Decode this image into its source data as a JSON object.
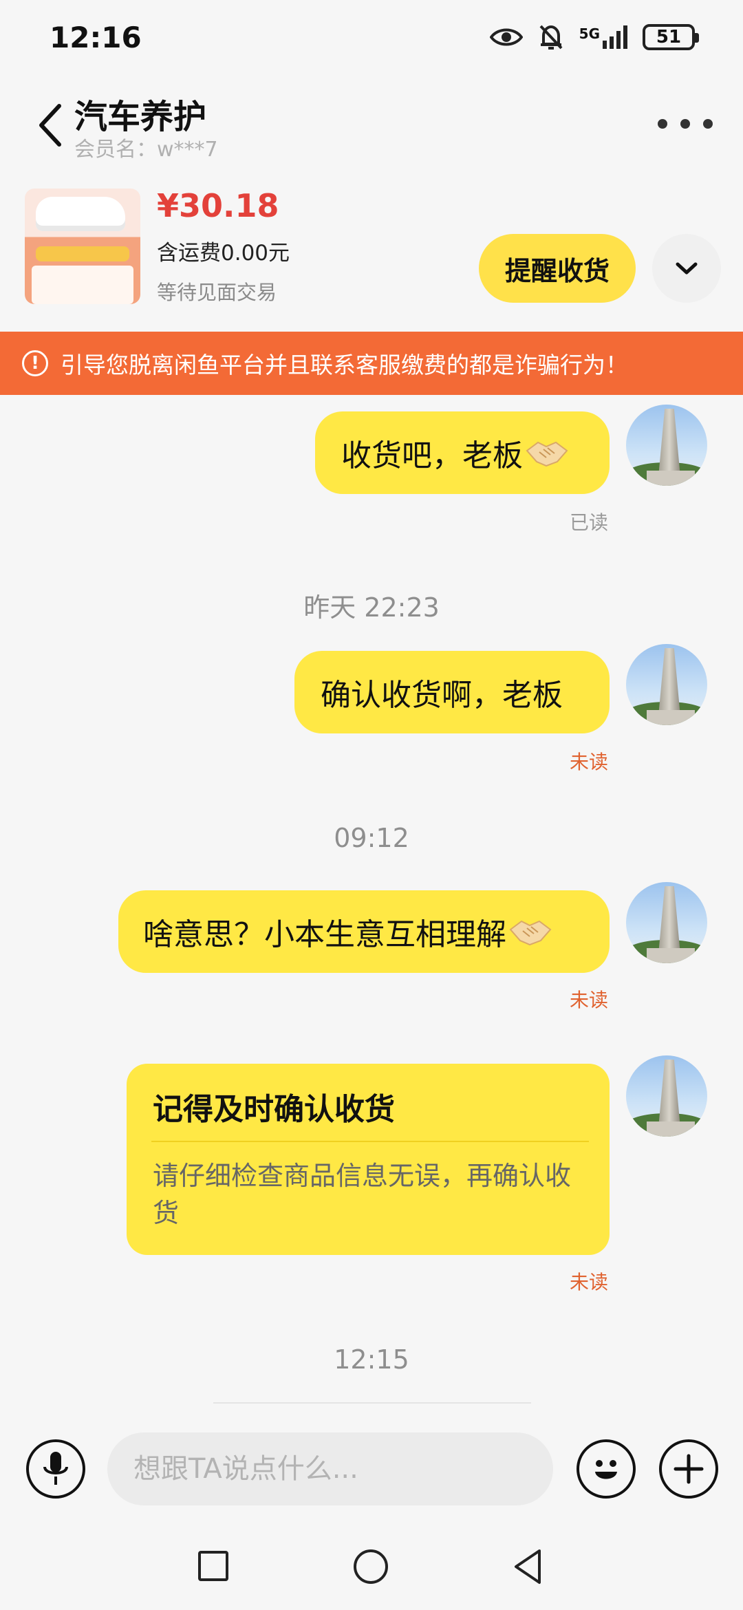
{
  "status_bar": {
    "time": "12:16",
    "network": "5G",
    "battery": "51",
    "icons": [
      "eye-icon",
      "bell-off-icon",
      "signal-icon",
      "battery-icon"
    ]
  },
  "header": {
    "title": "汽车养护",
    "member": "会员名：w***7"
  },
  "product": {
    "price": "¥30.18",
    "shipping": "含运费0.00元",
    "status": "等待见面交易",
    "remind_label": "提醒收货"
  },
  "warning": {
    "text": "引导您脱离闲鱼平台并且联系客服缴费的都是诈骗行为！"
  },
  "chat": {
    "messages": [
      {
        "text": "收货吧，老板",
        "emoji": "handshake",
        "status": "已读"
      },
      {
        "text": "确认收货啊，老板",
        "status": "未读"
      },
      {
        "text": "啥意思？小本生意互相理解",
        "emoji": "handshake",
        "status": "未读"
      }
    ],
    "timestamps": [
      "昨天 22:23",
      "09:12",
      "12:15"
    ],
    "card": {
      "title": "记得及时确认收货",
      "body": "请仔细检查商品信息无误，再确认收货",
      "status": "未读"
    }
  },
  "input": {
    "placeholder": "想跟TA说点什么..."
  },
  "colors": {
    "bubble": "#ffe845",
    "accent_button": "#ffe14a",
    "price": "#e3413a",
    "warning_bg": "#f36a36",
    "unread": "#e0622f"
  }
}
